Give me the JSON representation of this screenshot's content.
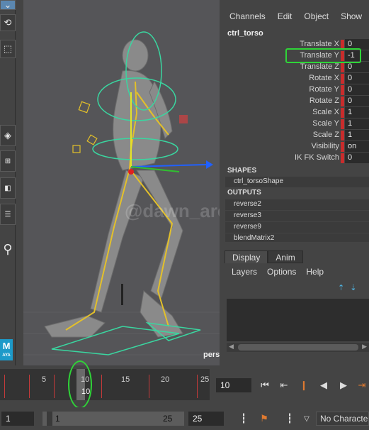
{
  "channel_box": {
    "menu": [
      "Channels",
      "Edit",
      "Object",
      "Show"
    ],
    "object_name": "ctrl_torso",
    "attributes": [
      {
        "name": "Translate X",
        "value": "0"
      },
      {
        "name": "Translate Y",
        "value": "-1"
      },
      {
        "name": "Translate Z",
        "value": "0"
      },
      {
        "name": "Rotate X",
        "value": "0"
      },
      {
        "name": "Rotate Y",
        "value": "0"
      },
      {
        "name": "Rotate Z",
        "value": "0"
      },
      {
        "name": "Scale X",
        "value": "1"
      },
      {
        "name": "Scale Y",
        "value": "1"
      },
      {
        "name": "Scale Z",
        "value": "1"
      },
      {
        "name": "Visibility",
        "value": "on"
      },
      {
        "name": "IK FK Switch",
        "value": "0"
      }
    ],
    "shapes_header": "SHAPES",
    "shape_node": "ctrl_torsoShape",
    "outputs_header": "OUTPUTS",
    "outputs": [
      "reverse2",
      "reverse3",
      "reverse9",
      "blendMatrix2"
    ]
  },
  "layer_editor": {
    "tabs": [
      "Display",
      "Anim"
    ],
    "menu": [
      "Layers",
      "Options",
      "Help"
    ]
  },
  "viewport": {
    "camera_label": "persp",
    "watermark": "@dawn_are"
  },
  "timeline": {
    "tick_labels": [
      "5",
      "10",
      "15",
      "20",
      "25"
    ],
    "current_frame": "10",
    "current_frame_field": "10"
  },
  "range": {
    "start": "1",
    "inner_start": "1",
    "inner_end": "25",
    "end": "25"
  },
  "character_set": "No Character",
  "toolbox": {
    "badge": "M",
    "badge_sub": "AYA"
  },
  "colors": {
    "highlight": "#2fd438",
    "keyed": "#c92c2c",
    "panel": "#444444"
  }
}
